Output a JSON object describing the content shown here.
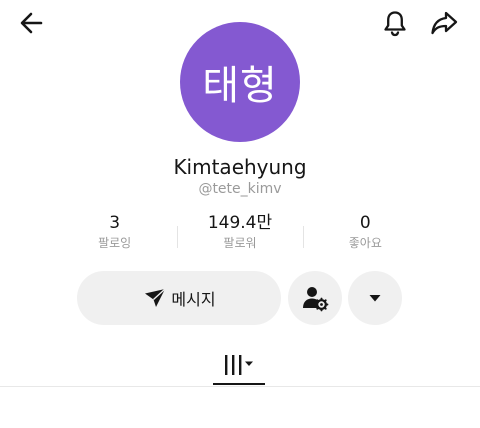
{
  "header": {
    "back_icon": "arrow-left-icon",
    "notification_icon": "bell-icon",
    "share_icon": "share-arrow-icon"
  },
  "profile": {
    "avatar_text": "태형",
    "avatar_color": "#8459d1",
    "display_name": "Kimtaehyung",
    "username": "@tete_kimv"
  },
  "stats": [
    {
      "value": "3",
      "label": "팔로잉"
    },
    {
      "value": "149.4만",
      "label": "팔로워"
    },
    {
      "value": "0",
      "label": "좋아요"
    }
  ],
  "actions": {
    "message_label": "메시지",
    "message_icon": "send-icon",
    "follow_settings_icon": "person-gear-icon",
    "more_icon": "caret-down-icon"
  },
  "tabs": {
    "active_icon": "grid-videos-icon"
  }
}
